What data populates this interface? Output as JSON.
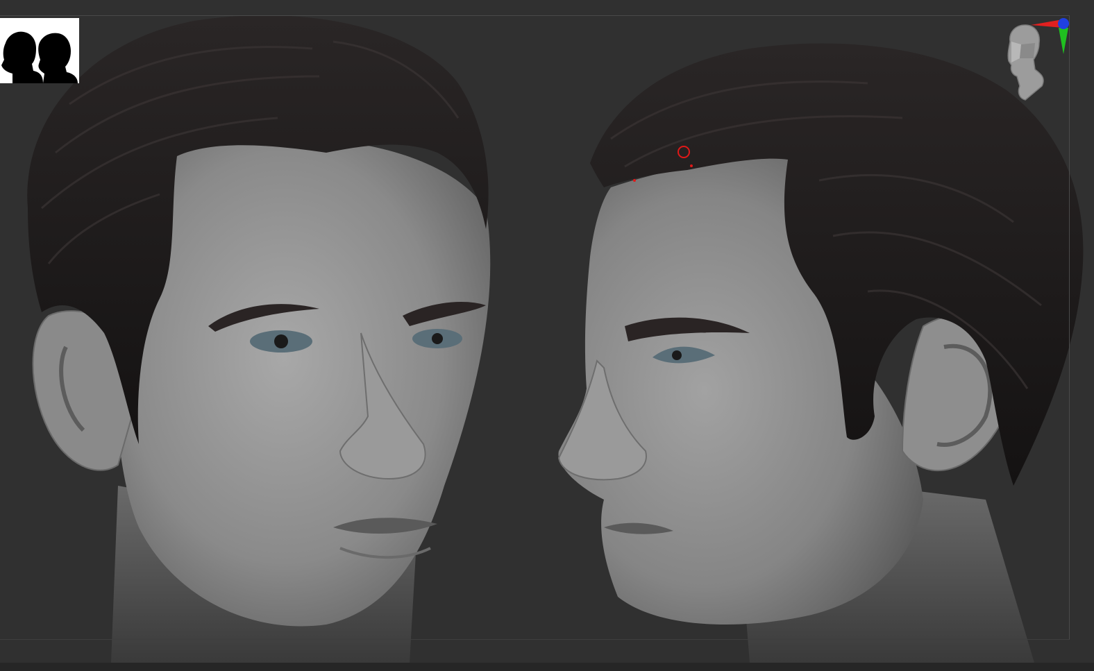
{
  "app": {
    "title": ""
  },
  "viewport": {
    "background_color": "#303030",
    "frame_color": "#4a4a4a"
  },
  "thumbnail_view": {
    "icon": "silhouette-heads-icon",
    "background_color": "#ffffff",
    "silhouette_color": "#000000"
  },
  "navigation_gizmo": {
    "icon": "head-orientation-icon",
    "axis_colors": {
      "x": "#e02020",
      "y": "#20c020",
      "z": "#2040e0"
    }
  },
  "model": {
    "views": [
      "front-three-quarter-view",
      "side-profile-view"
    ],
    "skin_color": "#8e8e8e",
    "hair_color": "#1c1a1a",
    "eye_color": "#5a6e78",
    "marker_color": "#e01818"
  }
}
